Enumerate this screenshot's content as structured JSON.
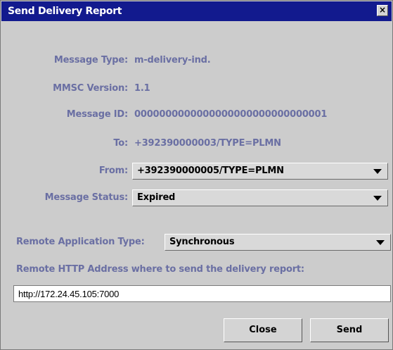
{
  "window": {
    "title": "Send Delivery Report",
    "close_glyph": "×"
  },
  "fields": {
    "message_type": {
      "label": "Message Type:",
      "value": "m-delivery-ind."
    },
    "mmsc_version": {
      "label": "MMSC Version:",
      "value": "1.1"
    },
    "message_id": {
      "label": "Message ID:",
      "value": "0000000000000000000000000000001"
    },
    "to": {
      "label": "To:",
      "value": "+392390000003/TYPE=PLMN"
    },
    "from": {
      "label": "From:",
      "value": "+392390000005/TYPE=PLMN"
    },
    "message_status": {
      "label": "Message Status:",
      "value": "Expired"
    },
    "remote_app_type": {
      "label": "Remote Application Type:",
      "value": "Synchronous"
    },
    "remote_http": {
      "label": "Remote HTTP Address where to send the delivery report:",
      "value": "http://172.24.45.105:7000"
    }
  },
  "buttons": {
    "close": "Close",
    "send": "Send"
  },
  "colors": {
    "titlebar": "#121a8e",
    "label": "#6a6fa3",
    "window_bg": "#cccccc"
  }
}
